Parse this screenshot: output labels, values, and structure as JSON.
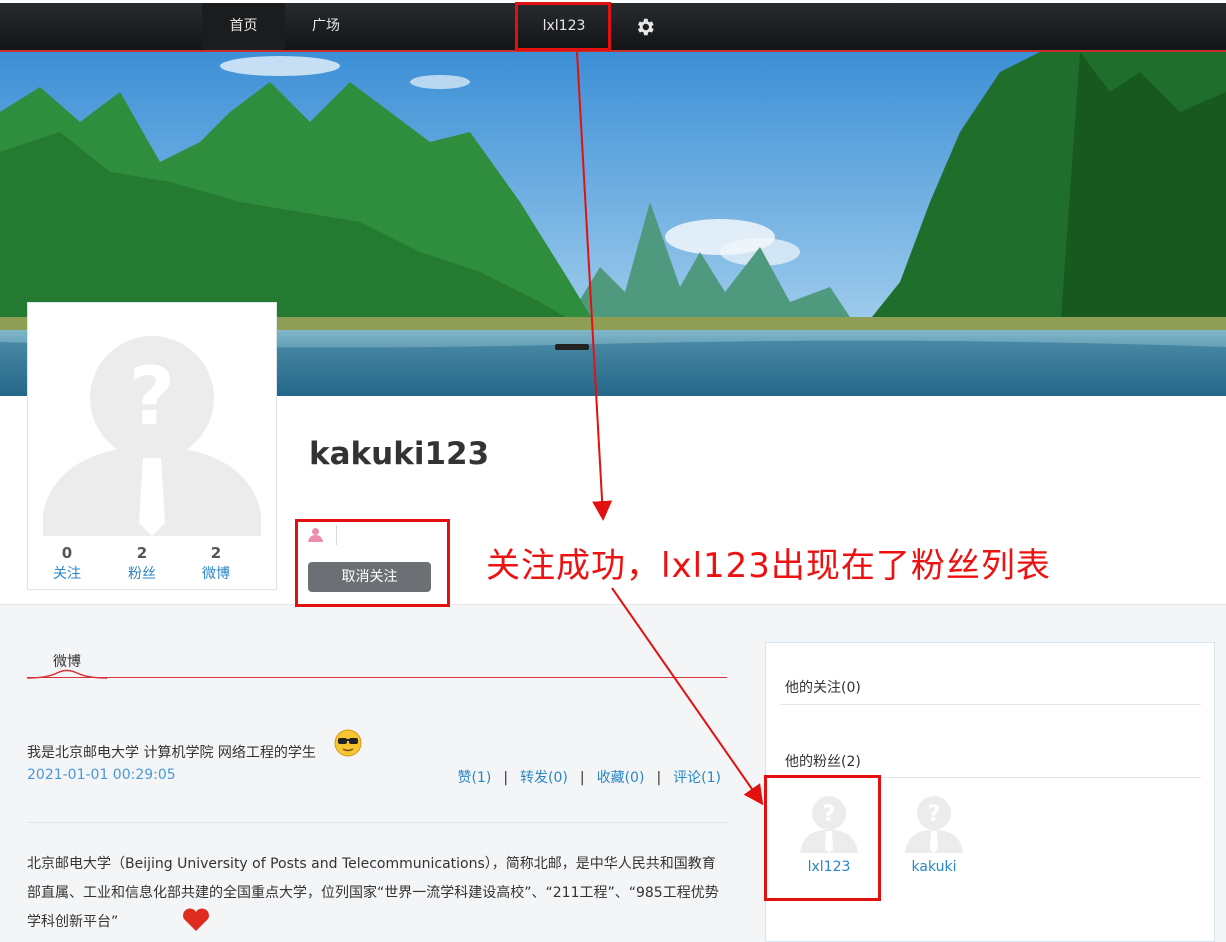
{
  "nav": {
    "home_label": "首页",
    "plaza_label": "广场",
    "user_label": "lxl123",
    "settings_icon": "gear-icon"
  },
  "profile": {
    "username": "kakuki123",
    "stats": [
      {
        "value": "0",
        "label": "关注"
      },
      {
        "value": "2",
        "label": "粉丝"
      },
      {
        "value": "2",
        "label": "微博"
      }
    ],
    "unfollow_label": "取消关注"
  },
  "annotation": {
    "text": "关注成功，lxl123出现在了粉丝列表",
    "color": "#ee1111"
  },
  "feed": {
    "tab_label": "微博",
    "posts": [
      {
        "text": "我是北京邮电大学 计算机学院 网络工程的学生",
        "time": "2021-01-01 00:29:05",
        "like": "赞(1)",
        "repost": "转发(0)",
        "favorite": "收藏(0)",
        "comment": "评论(1)"
      },
      {
        "text": "北京邮电大学（Beijing University of Posts and Telecommunications），简称北邮，是中华人民共和国教育部直属、工业和信息化部共建的全国重点大学，位列国家“世界一流学科建设高校”、“211工程”、“985工程优势学科创新平台”"
      }
    ]
  },
  "side": {
    "following_title": "他的关注(0)",
    "fans_title": "他的粉丝(2)",
    "fans": [
      {
        "name": "lxl123"
      },
      {
        "name": "kakuki"
      }
    ]
  },
  "colors": {
    "accent_red": "#d9313d",
    "link_blue": "#2a86c8",
    "button_gray": "#6c6f74"
  }
}
